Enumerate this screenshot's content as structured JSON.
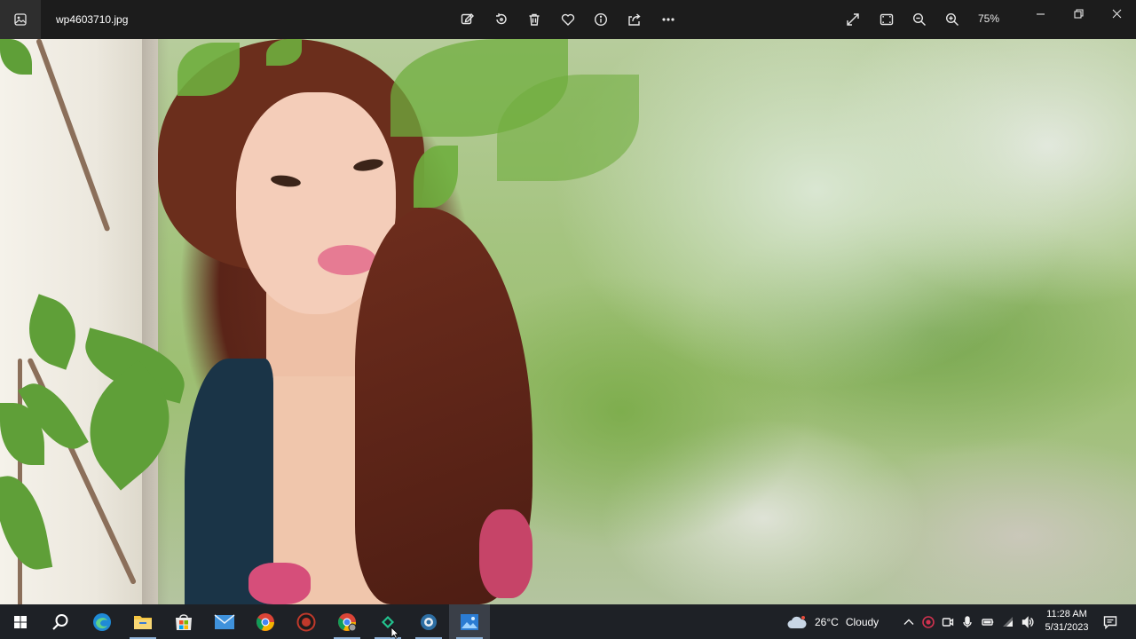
{
  "window": {
    "file_name": "wp4603710.jpg",
    "zoom_level": "75%"
  },
  "toolbar": {
    "icons": [
      "edit-image-icon",
      "rotate-icon",
      "delete-icon",
      "favorite-icon",
      "info-icon",
      "share-icon",
      "more-icon"
    ],
    "view_icons": [
      "fullscreen-icon",
      "fit-to-window-icon",
      "zoom-out-icon",
      "zoom-in-icon"
    ]
  },
  "window_controls": [
    "minimize-icon",
    "restore-icon",
    "close-icon"
  ],
  "taskbar": {
    "apps": [
      "windows-start-icon",
      "search-icon",
      "edge-icon",
      "file-explorer-icon",
      "microsoft-store-icon",
      "mail-icon",
      "chrome-icon",
      "red-app-icon",
      "chrome-profile-icon",
      "green-app-icon",
      "camera-app-icon",
      "photos-app-icon"
    ],
    "weather": {
      "temperature": "26°C",
      "condition": "Cloudy"
    },
    "tray_icons": [
      "chevron-up-icon",
      "red-circle-app-icon",
      "meet-now-icon",
      "microphone-icon",
      "battery-icon",
      "wifi-icon",
      "volume-icon"
    ],
    "clock": {
      "time": "11:28 AM",
      "date": "5/31/2023"
    }
  },
  "colors": {
    "titlebar_bg": "#1c1c1c",
    "taskbar_bg": "#1e2126",
    "accent": "#8fb3d9"
  }
}
